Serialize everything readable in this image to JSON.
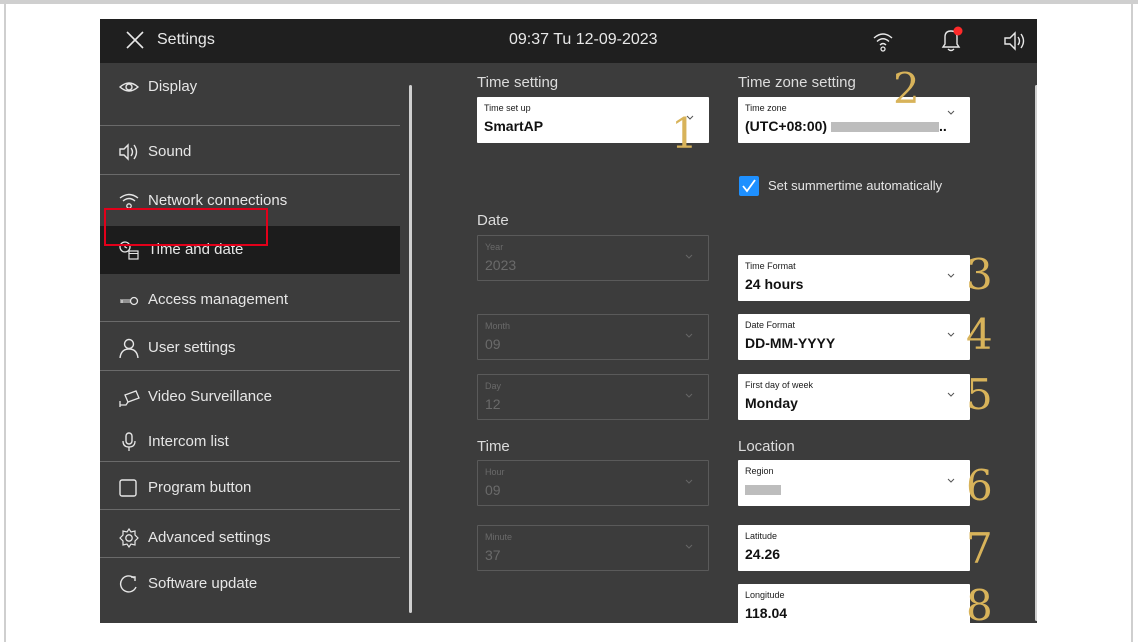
{
  "topbar": {
    "title": "Settings",
    "datetime": "09:37  Tu 12-09-2023"
  },
  "sidebar": {
    "items": [
      {
        "label": "Display",
        "icon": "eye-icon"
      },
      {
        "label": "Sound",
        "icon": "speaker-icon"
      },
      {
        "label": "Network connections",
        "icon": "network-icon"
      },
      {
        "label": "Time and date",
        "icon": "clock-calendar-icon",
        "active": true
      },
      {
        "label": "Access  management",
        "icon": "key-icon"
      },
      {
        "label": "User settings",
        "icon": "user-icon"
      },
      {
        "label": "Video Surveillance",
        "icon": "camera-icon"
      },
      {
        "label": "Intercom list",
        "icon": "microphone-icon"
      },
      {
        "label": "Program button",
        "icon": "square-icon"
      },
      {
        "label": "Advanced settings",
        "icon": "gear-icon"
      },
      {
        "label": "Software update",
        "icon": "update-icon"
      }
    ]
  },
  "main": {
    "time_setting": {
      "heading": "Time setting",
      "caption": "Time set up",
      "value": "SmartAP"
    },
    "time_zone": {
      "heading": "Time zone setting",
      "caption": "Time zone",
      "value": "(UTC+08:00)"
    },
    "summertime": {
      "label": "Set summertime automatically",
      "checked": true
    },
    "date": {
      "heading": "Date",
      "year": {
        "caption": "Year",
        "value": "2023"
      },
      "month": {
        "caption": "Month",
        "value": "09"
      },
      "day": {
        "caption": "Day",
        "value": "12"
      }
    },
    "time_format": {
      "caption": "Time Format",
      "value": "24 hours"
    },
    "date_format": {
      "caption": "Date Format",
      "value": "DD-MM-YYYY"
    },
    "first_day": {
      "caption": "First day of week",
      "value": "Monday"
    },
    "time": {
      "heading": "Time",
      "hour": {
        "caption": "Hour",
        "value": "09"
      },
      "minute": {
        "caption": "Minute",
        "value": "37"
      }
    },
    "location": {
      "heading": "Location",
      "region": {
        "caption": "Region",
        "value": ""
      },
      "latitude": {
        "caption": "Latitude",
        "value": "24.26"
      },
      "longitude": {
        "caption": "Longitude",
        "value": "118.04"
      }
    }
  },
  "callouts": [
    "1",
    "2",
    "3",
    "4",
    "5",
    "6",
    "7",
    "8"
  ],
  "colors": {
    "accent": "#1e90ff",
    "highlight": "#e2001a",
    "callout": "#d8b35a",
    "notification": "#ff2a2a"
  }
}
